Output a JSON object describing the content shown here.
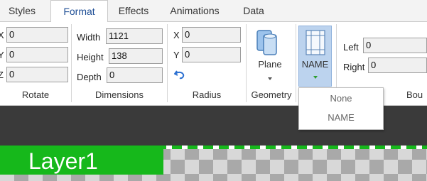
{
  "tabs": [
    {
      "label": "Styles"
    },
    {
      "label": "Format"
    },
    {
      "label": "Effects"
    },
    {
      "label": "Animations"
    },
    {
      "label": "Data"
    }
  ],
  "active_tab": "Format",
  "rotate": {
    "x_label": "X",
    "x_value": "0",
    "y_label": "Y",
    "y_value": "0",
    "z_label": "Z",
    "z_value": "0",
    "group_label": "Rotate"
  },
  "dimensions": {
    "width_label": "Width",
    "width_value": "1121",
    "height_label": "Height",
    "height_value": "138",
    "depth_label": "Depth",
    "depth_value": "0",
    "group_label": "Dimensions"
  },
  "radius": {
    "x_label": "X",
    "x_value": "0",
    "y_label": "Y",
    "y_value": "0",
    "undo_icon": "undo-arrow-icon",
    "group_label": "Radius"
  },
  "geometry": {
    "button_label": "Plane",
    "group_label": "Geometry"
  },
  "name_button": {
    "label": "NAME"
  },
  "bounds": {
    "left_label": "Left",
    "left_value": "0",
    "right_label": "Right",
    "right_value": "0",
    "group_label": "Bou"
  },
  "dropdown": {
    "items": [
      "None",
      "NAME"
    ]
  },
  "canvas": {
    "layer_label": "Layer1"
  },
  "colors": {
    "accent": "#1f4f96",
    "layer_green": "#16b81b",
    "name_button_bg": "#bcd3ee"
  }
}
